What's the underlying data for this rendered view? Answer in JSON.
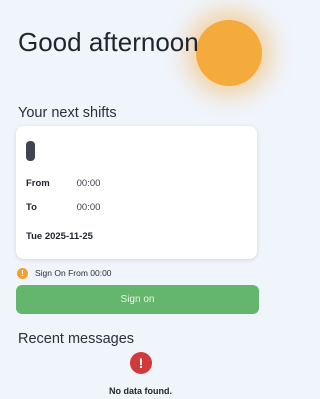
{
  "header": {
    "greeting": "Good afternoon"
  },
  "shifts": {
    "title": "Your next shifts",
    "card": {
      "from_label": "From",
      "from_value": "00:00",
      "to_label": "To",
      "to_value": "00:00",
      "date": "Tue 2025-11-25"
    },
    "info_icon": "info-icon",
    "info_text": "Sign On From 00:00",
    "sign_on_label": "Sign on"
  },
  "messages": {
    "title": "Recent messages",
    "error_icon": "alert-icon",
    "empty_text": "No data found."
  },
  "colors": {
    "background": "#f0f4fb",
    "accent_sun": "#f5aa3c",
    "sign_on_button": "#65b66d",
    "info_icon": "#f0a030",
    "error_icon": "#cf3b3b"
  }
}
